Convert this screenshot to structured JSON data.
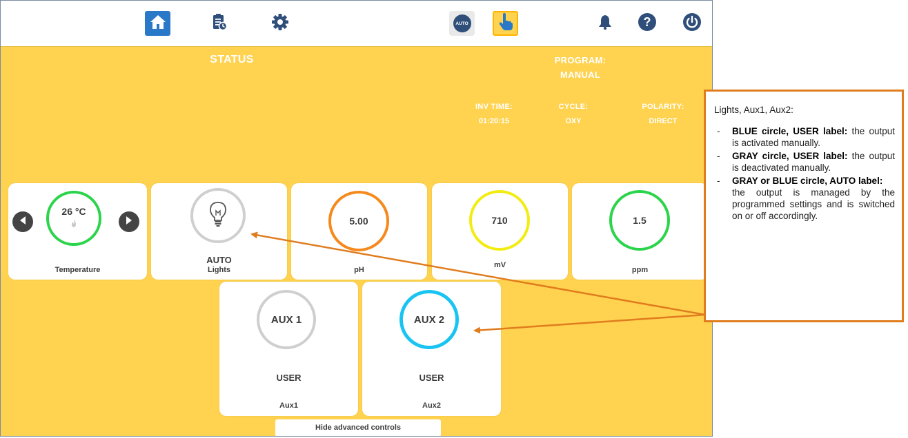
{
  "toolbar": {
    "home_icon": "home-icon",
    "report_icon": "clipboard-clock-icon",
    "settings_icon": "gear-icon",
    "auto_label": "AUTO",
    "manual_icon": "hand-pointer-icon",
    "alarm_icon": "bell-icon",
    "help_icon": "question-icon",
    "power_icon": "power-icon"
  },
  "status": {
    "title": "STATUS",
    "program_label": "PROGRAM:",
    "program_value": "MANUAL",
    "inv_time_label": "INV TIME:",
    "inv_time_value": "01:20:15",
    "cycle_label": "CYCLE:",
    "cycle_value": "OXY",
    "polarity_label": "POLARITY:",
    "polarity_value": "DIRECT"
  },
  "cards": {
    "temperature": {
      "value": "26 °C",
      "label": "Temperature",
      "ring_color": "#2bd44a"
    },
    "lights": {
      "mode": "AUTO",
      "label": "Lights",
      "ring_color": "#cfcfcf"
    },
    "ph": {
      "value": "5.00",
      "label": "pH",
      "ring_color": "#f5891c"
    },
    "mv": {
      "value": "710",
      "label": "mV",
      "ring_color": "#f2ec12"
    },
    "ppm": {
      "value": "1.5",
      "label": "ppm",
      "ring_color": "#2bd44a"
    },
    "aux1": {
      "value": "AUX 1",
      "mode": "USER",
      "label": "Aux1",
      "ring_color": "#cfcfcf"
    },
    "aux2": {
      "value": "AUX 2",
      "mode": "USER",
      "label": "Aux2",
      "ring_color": "#19c4f2"
    }
  },
  "hide_button": "Hide advanced controls",
  "note": {
    "intro": "Lights, Aux1, Aux2:",
    "items": [
      {
        "bold": "BLUE circle, USER label:",
        "text": "the output is activated manually."
      },
      {
        "bold": "GRAY circle, USER label:",
        "text": "the output is deactivated manually."
      },
      {
        "bold": "GRAY or BLUE circle, AUTO label:",
        "text": "the output is managed by the programmed settings and is switched on or off accordingly."
      }
    ]
  },
  "colors": {
    "background": "#ffd24f",
    "accent_blue": "#2a79c8",
    "callout_orange": "#e07c1e"
  }
}
